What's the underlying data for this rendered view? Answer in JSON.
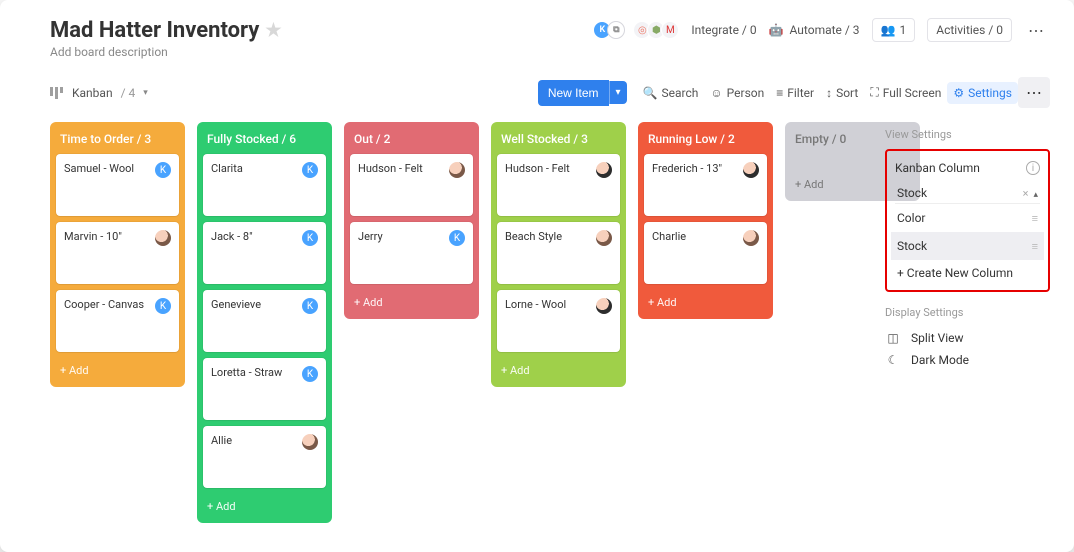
{
  "header": {
    "title": "Mad Hatter Inventory",
    "subtitle": "Add board description",
    "integrate": "Integrate / 0",
    "automate": "Automate / 3",
    "people": "1",
    "activities": "Activities / 0"
  },
  "toolbar": {
    "view_label": "Kanban",
    "view_count": "/ 4",
    "new_item": "New Item",
    "search": "Search",
    "person": "Person",
    "filter": "Filter",
    "sort": "Sort",
    "fullscreen": "Full Screen",
    "settings": "Settings"
  },
  "lanes": [
    {
      "title": "Time to Order / 3",
      "color": "orange",
      "cards": [
        {
          "label": "Samuel - Wool",
          "avatar": "letter",
          "letter": "K"
        },
        {
          "label": "Marvin - 10\"",
          "avatar": "photo1"
        },
        {
          "label": "Cooper - Canvas",
          "avatar": "letter",
          "letter": "K"
        }
      ],
      "add": "+ Add"
    },
    {
      "title": "Fully Stocked / 6",
      "color": "green",
      "cards": [
        {
          "label": "Clarita",
          "avatar": "letter",
          "letter": "K"
        },
        {
          "label": "Jack - 8\"",
          "avatar": "letter",
          "letter": "K"
        },
        {
          "label": "Genevieve",
          "avatar": "letter",
          "letter": "K"
        },
        {
          "label": "Loretta - Straw",
          "avatar": "letter",
          "letter": "K"
        },
        {
          "label": "Allie",
          "avatar": "photo1"
        }
      ],
      "add": "+ Add"
    },
    {
      "title": "Out / 2",
      "color": "red",
      "cards": [
        {
          "label": "Hudson - Felt",
          "avatar": "photo1"
        },
        {
          "label": "Jerry",
          "avatar": "letter",
          "letter": "K"
        }
      ],
      "add": "+ Add"
    },
    {
      "title": "Well Stocked / 3",
      "color": "lime",
      "cards": [
        {
          "label": "Hudson - Felt",
          "avatar": "photo2"
        },
        {
          "label": "Beach Style",
          "avatar": "photo1"
        },
        {
          "label": "Lorne - Wool",
          "avatar": "photo2"
        }
      ],
      "add": "+ Add"
    },
    {
      "title": "Running Low / 2",
      "color": "redor",
      "cards": [
        {
          "label": "Frederich - 13\"",
          "avatar": "photo2"
        },
        {
          "label": "Charlie",
          "avatar": "photo1"
        }
      ],
      "add": "+ Add"
    },
    {
      "title": "Empty / 0",
      "color": "grey",
      "cards": [],
      "add": "+ Add"
    }
  ],
  "sidepanel": {
    "view_settings_h": "View Settings",
    "kanban_column": "Kanban Column",
    "selected": "Stock",
    "options": [
      "Color",
      "Stock"
    ],
    "create_new": "+ Create New Column",
    "display_settings_h": "Display Settings",
    "split_view": "Split View",
    "dark_mode": "Dark Mode"
  }
}
